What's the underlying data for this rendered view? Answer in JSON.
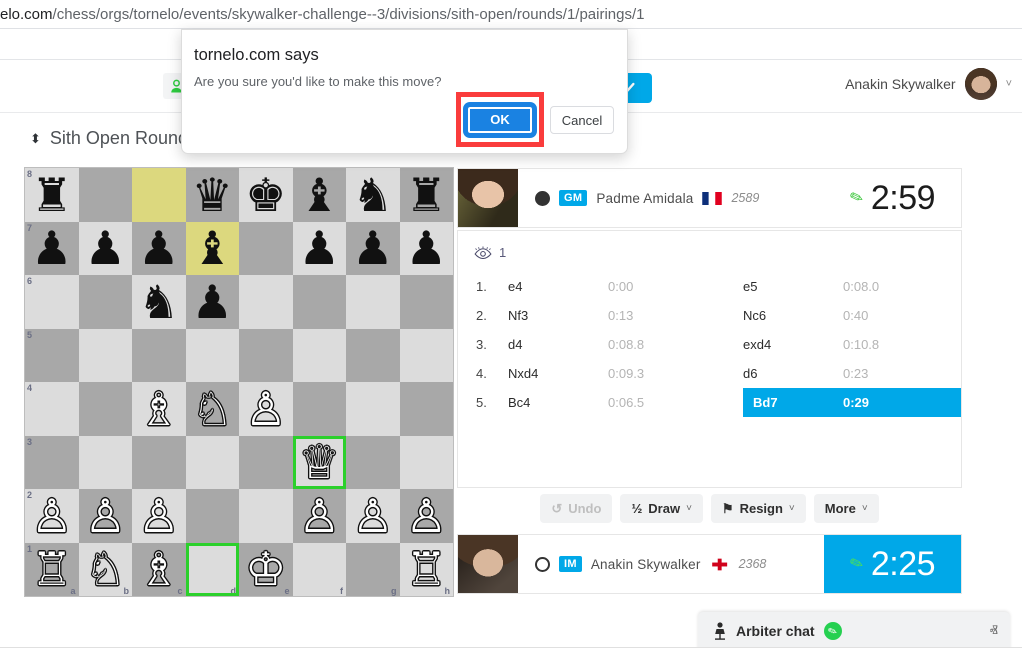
{
  "browser": {
    "url_host": "elo.com",
    "url_path": "/chess/orgs/tornelo/events/skywalker-challenge--3/divisions/sith-open/rounds/1/pairings/1"
  },
  "header": {
    "user_name": "Anakin Skywalker",
    "user_chevron": "˅",
    "user_chip_icon": "person-green-icon",
    "blue_button_icon": "check-icon"
  },
  "round": {
    "sort_icon": "⬍",
    "title": "Sith Open Round"
  },
  "dialog": {
    "title": "tornelo.com says",
    "message": "Are you sure you'd like to make this move?",
    "ok_label": "OK",
    "cancel_label": "Cancel",
    "highlight_color": "#fa3c3c",
    "ok_color": "#1a82e2"
  },
  "board": {
    "selected_squares": [
      "d1",
      "f3"
    ],
    "highlighted_squares": [
      "c8",
      "d7"
    ],
    "files": [
      "a",
      "b",
      "c",
      "d",
      "e",
      "f",
      "g",
      "h"
    ],
    "ranks": [
      "8",
      "7",
      "6",
      "5",
      "4",
      "3",
      "2",
      "1"
    ],
    "light_color": "#dcdcdc",
    "dark_color": "#a8a8a8",
    "highlight_color": "#dcd87e",
    "select_color": "#2bd02b",
    "rows": [
      [
        {
          "sq": "a8",
          "piece": "♜",
          "color": "b"
        },
        {
          "sq": "b8",
          "piece": "",
          "color": ""
        },
        {
          "sq": "c8",
          "piece": "",
          "color": ""
        },
        {
          "sq": "d8",
          "piece": "♛",
          "color": "b"
        },
        {
          "sq": "e8",
          "piece": "♚",
          "color": "b"
        },
        {
          "sq": "f8",
          "piece": "♝",
          "color": "b"
        },
        {
          "sq": "g8",
          "piece": "♞",
          "color": "b"
        },
        {
          "sq": "h8",
          "piece": "♜",
          "color": "b"
        }
      ],
      [
        {
          "sq": "a7",
          "piece": "♟",
          "color": "b"
        },
        {
          "sq": "b7",
          "piece": "♟",
          "color": "b"
        },
        {
          "sq": "c7",
          "piece": "♟",
          "color": "b"
        },
        {
          "sq": "d7",
          "piece": "♝",
          "color": "b"
        },
        {
          "sq": "e7",
          "piece": "",
          "color": ""
        },
        {
          "sq": "f7",
          "piece": "♟",
          "color": "b"
        },
        {
          "sq": "g7",
          "piece": "♟",
          "color": "b"
        },
        {
          "sq": "h7",
          "piece": "♟",
          "color": "b"
        }
      ],
      [
        {
          "sq": "a6",
          "piece": "",
          "color": ""
        },
        {
          "sq": "b6",
          "piece": "",
          "color": ""
        },
        {
          "sq": "c6",
          "piece": "♞",
          "color": "b"
        },
        {
          "sq": "d6",
          "piece": "♟",
          "color": "b"
        },
        {
          "sq": "e6",
          "piece": "",
          "color": ""
        },
        {
          "sq": "f6",
          "piece": "",
          "color": ""
        },
        {
          "sq": "g6",
          "piece": "",
          "color": ""
        },
        {
          "sq": "h6",
          "piece": "",
          "color": ""
        }
      ],
      [
        {
          "sq": "a5",
          "piece": "",
          "color": ""
        },
        {
          "sq": "b5",
          "piece": "",
          "color": ""
        },
        {
          "sq": "c5",
          "piece": "",
          "color": ""
        },
        {
          "sq": "d5",
          "piece": "",
          "color": ""
        },
        {
          "sq": "e5",
          "piece": "",
          "color": ""
        },
        {
          "sq": "f5",
          "piece": "",
          "color": ""
        },
        {
          "sq": "g5",
          "piece": "",
          "color": ""
        },
        {
          "sq": "h5",
          "piece": "",
          "color": ""
        }
      ],
      [
        {
          "sq": "a4",
          "piece": "",
          "color": ""
        },
        {
          "sq": "b4",
          "piece": "",
          "color": ""
        },
        {
          "sq": "c4",
          "piece": "♗",
          "color": "w"
        },
        {
          "sq": "d4",
          "piece": "♘",
          "color": "w"
        },
        {
          "sq": "e4",
          "piece": "♙",
          "color": "w"
        },
        {
          "sq": "f4",
          "piece": "",
          "color": ""
        },
        {
          "sq": "g4",
          "piece": "",
          "color": ""
        },
        {
          "sq": "h4",
          "piece": "",
          "color": ""
        }
      ],
      [
        {
          "sq": "a3",
          "piece": "",
          "color": ""
        },
        {
          "sq": "b3",
          "piece": "",
          "color": ""
        },
        {
          "sq": "c3",
          "piece": "",
          "color": ""
        },
        {
          "sq": "d3",
          "piece": "",
          "color": ""
        },
        {
          "sq": "e3",
          "piece": "",
          "color": ""
        },
        {
          "sq": "f3",
          "piece": "♕",
          "color": "w"
        },
        {
          "sq": "g3",
          "piece": "",
          "color": ""
        },
        {
          "sq": "h3",
          "piece": "",
          "color": ""
        }
      ],
      [
        {
          "sq": "a2",
          "piece": "♙",
          "color": "w"
        },
        {
          "sq": "b2",
          "piece": "♙",
          "color": "w"
        },
        {
          "sq": "c2",
          "piece": "♙",
          "color": "w"
        },
        {
          "sq": "d2",
          "piece": "",
          "color": ""
        },
        {
          "sq": "e2",
          "piece": "",
          "color": ""
        },
        {
          "sq": "f2",
          "piece": "♙",
          "color": "w"
        },
        {
          "sq": "g2",
          "piece": "♙",
          "color": "w"
        },
        {
          "sq": "h2",
          "piece": "♙",
          "color": "w"
        }
      ],
      [
        {
          "sq": "a1",
          "piece": "♖",
          "color": "w"
        },
        {
          "sq": "b1",
          "piece": "♘",
          "color": "w"
        },
        {
          "sq": "c1",
          "piece": "♗",
          "color": "w"
        },
        {
          "sq": "d1",
          "piece": "",
          "color": ""
        },
        {
          "sq": "e1",
          "piece": "♔",
          "color": "w"
        },
        {
          "sq": "f1",
          "piece": "",
          "color": ""
        },
        {
          "sq": "g1",
          "piece": "",
          "color": ""
        },
        {
          "sq": "h1",
          "piece": "♖",
          "color": "w"
        }
      ]
    ]
  },
  "players": {
    "top": {
      "color": "black",
      "title": "GM",
      "name": "Padme Amidala",
      "flag": "france-flag",
      "rating": "2589",
      "clock": "2:59",
      "clock_active": false,
      "avatar": "padme-avatar"
    },
    "bottom": {
      "color": "white",
      "title": "IM",
      "name": "Anakin Skywalker",
      "flag": "red-cross-flag",
      "rating": "2368",
      "clock": "2:25",
      "clock_active": true,
      "avatar": "anakin-avatar"
    }
  },
  "spectators": {
    "icon": "eye-icon",
    "count": "1"
  },
  "moves": {
    "rows": [
      {
        "num": "1.",
        "white_san": "e4",
        "white_time": "0:00",
        "black_san": "e5",
        "black_time": "0:08.0",
        "black_active": false
      },
      {
        "num": "2.",
        "white_san": "Nf3",
        "white_time": "0:13",
        "black_san": "Nc6",
        "black_time": "0:40",
        "black_active": false
      },
      {
        "num": "3.",
        "white_san": "d4",
        "white_time": "0:08.8",
        "black_san": "exd4",
        "black_time": "0:10.8",
        "black_active": false
      },
      {
        "num": "4.",
        "white_san": "Nxd4",
        "white_time": "0:09.3",
        "black_san": "d6",
        "black_time": "0:23",
        "black_active": false
      },
      {
        "num": "5.",
        "white_san": "Bc4",
        "white_time": "0:06.5",
        "black_san": "Bd7",
        "black_time": "0:29",
        "black_active": true
      }
    ]
  },
  "actions": {
    "undo": {
      "label": "Undo",
      "icon": "↺",
      "disabled": true
    },
    "draw": {
      "label": "Draw",
      "icon": "½",
      "caret": "˅"
    },
    "resign": {
      "label": "Resign",
      "icon": "⚑",
      "caret": "˅"
    },
    "more": {
      "label": "More",
      "caret": "˅"
    }
  },
  "arbiter_chat": {
    "icon": "arbiter-icon",
    "label": "Arbiter chat",
    "status_icon": "pencil-icon",
    "expand_icon": "ⱏ",
    "status_color": "#25d050"
  }
}
